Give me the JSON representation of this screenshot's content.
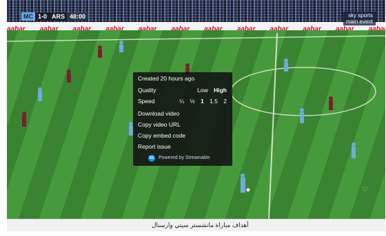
{
  "scorebug": {
    "home": "MC",
    "score": "1-0",
    "away": "ARS",
    "time": "48:00"
  },
  "broadcaster": {
    "line1": "sky sports",
    "line2": "main event"
  },
  "adboard": {
    "brand": "aabar"
  },
  "menu": {
    "created": "Created 20 hours ago",
    "quality_label": "Quality",
    "quality_options": [
      "Low",
      "High"
    ],
    "speed_label": "Speed",
    "speed_options": [
      "¼",
      "½",
      "1",
      "1.5",
      "2"
    ],
    "download": "Download video",
    "copy_url": "Copy video URL",
    "copy_embed": "Copy embed code",
    "report": "Report issue",
    "powered_by": "Powered by Streamable"
  },
  "caption": {
    "text": "أهداف مباراة مانشستر سيتي وارسنال"
  },
  "colors": {
    "pitch": "#3f8a33",
    "menu_bg": "#121212",
    "city": "#6cabdd",
    "arsenal": "#7a1f2b",
    "brand": "#0f90fa"
  },
  "icons": {
    "heart": "heart-icon",
    "streamable": "streamable-logo-icon"
  }
}
